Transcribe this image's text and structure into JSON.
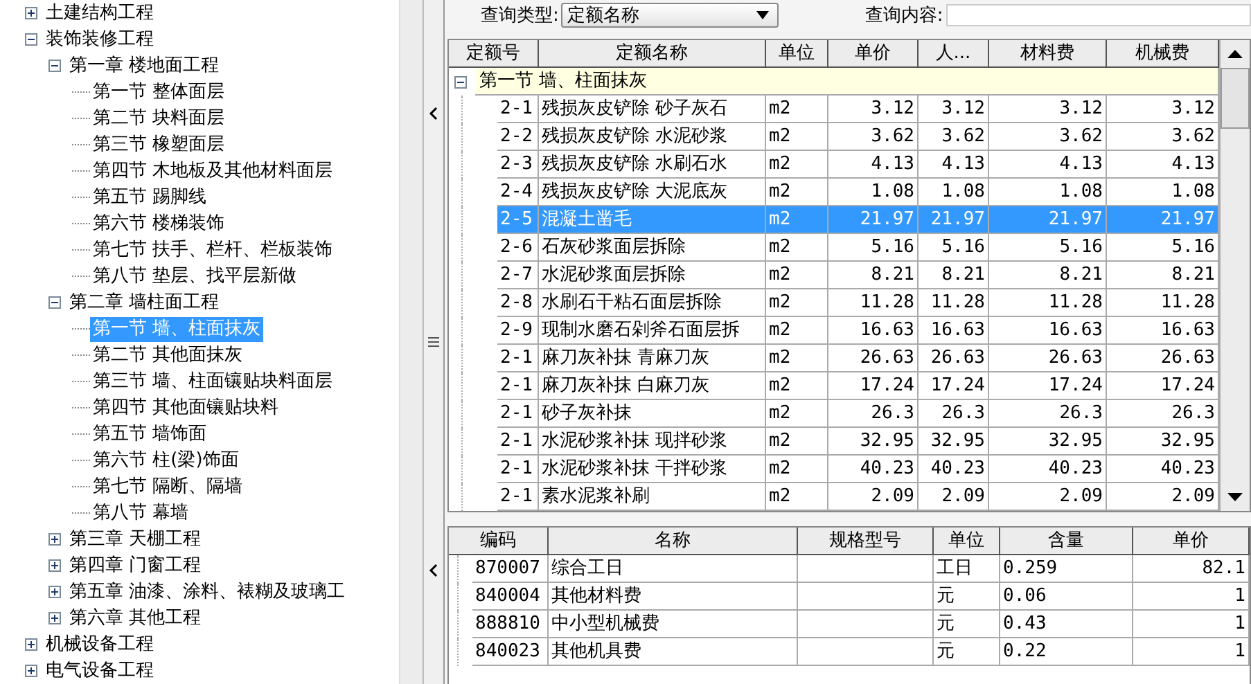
{
  "tree": [
    {
      "label": "土建结构工程",
      "expanded": false,
      "selected": false
    },
    {
      "label": "装饰装修工程",
      "expanded": true,
      "selected": false,
      "children": [
        {
          "label": "第一章  楼地面工程",
          "expanded": true,
          "selected": false,
          "children": [
            {
              "label": "第一节  整体面层",
              "selected": false
            },
            {
              "label": "第二节  块料面层",
              "selected": false
            },
            {
              "label": "第三节  橡塑面层",
              "selected": false
            },
            {
              "label": "第四节  木地板及其他材料面层",
              "selected": false
            },
            {
              "label": "第五节  踢脚线",
              "selected": false
            },
            {
              "label": "第六节  楼梯装饰",
              "selected": false
            },
            {
              "label": "第七节  扶手、栏杆、栏板装饰",
              "selected": false
            },
            {
              "label": "第八节  垫层、找平层新做",
              "selected": false
            }
          ]
        },
        {
          "label": "第二章  墙柱面工程",
          "expanded": true,
          "selected": false,
          "children": [
            {
              "label": "第一节  墙、柱面抹灰",
              "selected": true
            },
            {
              "label": "第二节  其他面抹灰",
              "selected": false
            },
            {
              "label": "第三节  墙、柱面镶贴块料面层",
              "selected": false
            },
            {
              "label": "第四节  其他面镶贴块料",
              "selected": false
            },
            {
              "label": "第五节  墙饰面",
              "selected": false
            },
            {
              "label": "第六节  柱(梁)饰面",
              "selected": false
            },
            {
              "label": "第七节  隔断、隔墙",
              "selected": false
            },
            {
              "label": "第八节  幕墙",
              "selected": false
            }
          ]
        },
        {
          "label": "第三章  天棚工程",
          "expanded": false,
          "selected": false
        },
        {
          "label": "第四章  门窗工程",
          "expanded": false,
          "selected": false
        },
        {
          "label": "第五章  油漆、涂料、裱糊及玻璃工",
          "expanded": false,
          "selected": false
        },
        {
          "label": "第六章  其他工程",
          "expanded": false,
          "selected": false
        }
      ]
    },
    {
      "label": "机械设备工程",
      "expanded": false,
      "selected": false
    },
    {
      "label": "电气设备工程",
      "expanded": false,
      "selected": false
    }
  ],
  "query": {
    "type_label": "查询类型:",
    "type_value": "定额名称",
    "content_label": "查询内容:"
  },
  "quota_table": {
    "columns": [
      "定额号",
      "定额名称",
      "单位",
      "单价",
      "人...",
      "材料费",
      "机械费"
    ],
    "group": {
      "label": "第一节  墙、柱面抹灰",
      "expanded": true
    },
    "rows": [
      {
        "code": "2-1",
        "name": "残损灰皮铲除 砂子灰石",
        "unit": "m2",
        "price": "3.12",
        "labor": "3.12",
        "material": "3.12",
        "machine": "3.12",
        "selected": false
      },
      {
        "code": "2-2",
        "name": "残损灰皮铲除 水泥砂浆",
        "unit": "m2",
        "price": "3.62",
        "labor": "3.62",
        "material": "3.62",
        "machine": "3.62",
        "selected": false
      },
      {
        "code": "2-3",
        "name": "残损灰皮铲除 水刷石水",
        "unit": "m2",
        "price": "4.13",
        "labor": "4.13",
        "material": "4.13",
        "machine": "4.13",
        "selected": false
      },
      {
        "code": "2-4",
        "name": "残损灰皮铲除 大泥底灰",
        "unit": "m2",
        "price": "1.08",
        "labor": "1.08",
        "material": "1.08",
        "machine": "1.08",
        "selected": false
      },
      {
        "code": "2-5",
        "name": "混凝土凿毛",
        "unit": "m2",
        "price": "21.97",
        "labor": "21.97",
        "material": "21.97",
        "machine": "21.97",
        "selected": true
      },
      {
        "code": "2-6",
        "name": "石灰砂浆面层拆除",
        "unit": "m2",
        "price": "5.16",
        "labor": "5.16",
        "material": "5.16",
        "machine": "5.16",
        "selected": false
      },
      {
        "code": "2-7",
        "name": "水泥砂浆面层拆除",
        "unit": "m2",
        "price": "8.21",
        "labor": "8.21",
        "material": "8.21",
        "machine": "8.21",
        "selected": false
      },
      {
        "code": "2-8",
        "name": "水刷石干粘石面层拆除",
        "unit": "m2",
        "price": "11.28",
        "labor": "11.28",
        "material": "11.28",
        "machine": "11.28",
        "selected": false
      },
      {
        "code": "2-9",
        "name": "现制水磨石剁斧石面层拆",
        "unit": "m2",
        "price": "16.63",
        "labor": "16.63",
        "material": "16.63",
        "machine": "16.63",
        "selected": false
      },
      {
        "code": "2-1",
        "name": "麻刀灰补抹 青麻刀灰",
        "unit": "m2",
        "price": "26.63",
        "labor": "26.63",
        "material": "26.63",
        "machine": "26.63",
        "selected": false
      },
      {
        "code": "2-1",
        "name": "麻刀灰补抹 白麻刀灰",
        "unit": "m2",
        "price": "17.24",
        "labor": "17.24",
        "material": "17.24",
        "machine": "17.24",
        "selected": false
      },
      {
        "code": "2-1",
        "name": "砂子灰补抹",
        "unit": "m2",
        "price": "26.3",
        "labor": "26.3",
        "material": "26.3",
        "machine": "26.3",
        "selected": false
      },
      {
        "code": "2-1",
        "name": "水泥砂浆补抹 现拌砂浆",
        "unit": "m2",
        "price": "32.95",
        "labor": "32.95",
        "material": "32.95",
        "machine": "32.95",
        "selected": false
      },
      {
        "code": "2-1",
        "name": "水泥砂浆补抹 干拌砂浆",
        "unit": "m2",
        "price": "40.23",
        "labor": "40.23",
        "material": "40.23",
        "machine": "40.23",
        "selected": false
      },
      {
        "code": "2-1",
        "name": "素水泥浆补刷",
        "unit": "m2",
        "price": "2.09",
        "labor": "2.09",
        "material": "2.09",
        "machine": "2.09",
        "selected": false
      }
    ]
  },
  "resource_table": {
    "columns": [
      "编码",
      "名称",
      "规格型号",
      "单位",
      "含量",
      "单价"
    ],
    "rows": [
      {
        "code": "870007",
        "name": "综合工日",
        "unit": "工日",
        "amount": "0.259",
        "price": "82.1"
      },
      {
        "code": "840004",
        "name": "其他材料费",
        "unit": "元",
        "amount": "0.06",
        "price": "1"
      },
      {
        "code": "888810",
        "name": "中小型机械费",
        "unit": "元",
        "amount": "0.43",
        "price": "1"
      },
      {
        "code": "840023",
        "name": "其他机具费",
        "unit": "元",
        "amount": "0.22",
        "price": "1"
      }
    ]
  }
}
